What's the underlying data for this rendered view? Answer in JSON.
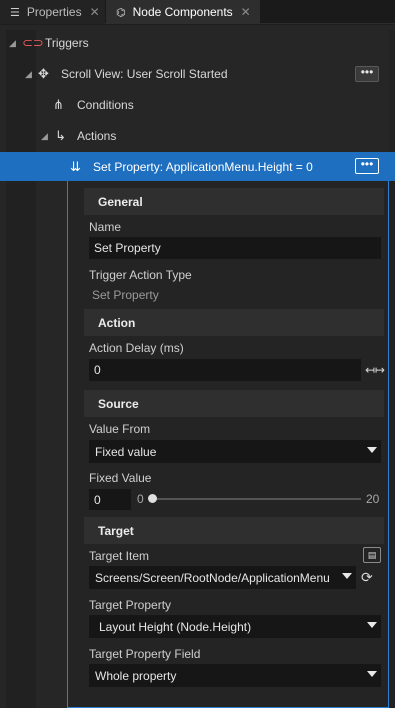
{
  "tabs": [
    {
      "label": "Properties",
      "icon": "list-icon",
      "active": false
    },
    {
      "label": "Node Components",
      "icon": "node-components-icon",
      "active": true
    }
  ],
  "tree": {
    "triggers": {
      "label": "Triggers",
      "icon": "trigger-icon",
      "icon_color": "#e05a5a"
    },
    "scroll_view": {
      "label": "Scroll View: User Scroll Started",
      "icon": "move-icon"
    },
    "conditions": {
      "label": "Conditions",
      "icon": "hierarchy-icon"
    },
    "actions": {
      "label": "Actions",
      "icon": "action-arrow-icon"
    },
    "set_property": {
      "label": "Set Property: ApplicationMenu.Height = 0",
      "icon": "set-property-icon"
    },
    "more_label": "•••"
  },
  "accent_color": "#1e6fbf",
  "panel": {
    "general": {
      "title": "General",
      "name_label": "Name",
      "name_value": "Set Property",
      "trigger_action_type_label": "Trigger Action Type",
      "trigger_action_type_value": "Set Property"
    },
    "action": {
      "title": "Action",
      "delay_label": "Action Delay (ms)",
      "delay_value": "0"
    },
    "source": {
      "title": "Source",
      "value_from_label": "Value From",
      "value_from_value": "Fixed value",
      "fixed_value_label": "Fixed Value",
      "fixed_value_value": "0",
      "slider_min": "0",
      "slider_max": "20",
      "slider_value": 0
    },
    "target": {
      "title": "Target",
      "item_label": "Target Item",
      "item_value": "Screens/Screen/RootNode/ApplicationMenu",
      "property_label": "Target Property",
      "property_value": "Layout Height (Node.Height)",
      "property_field_label": "Target Property Field",
      "property_field_value": "Whole property"
    }
  }
}
